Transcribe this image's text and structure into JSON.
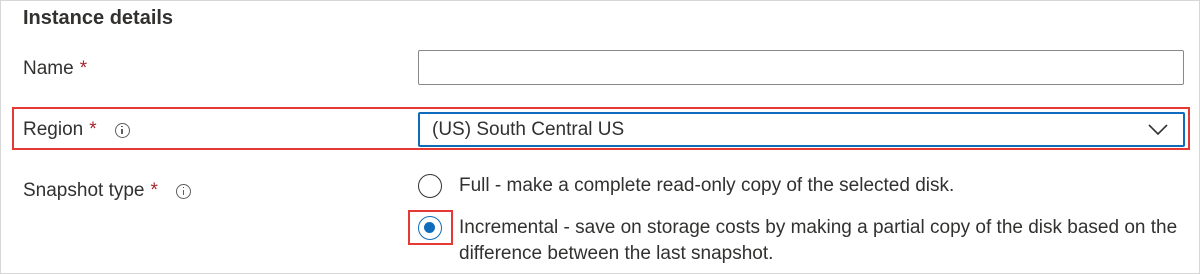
{
  "section": {
    "title": "Instance details"
  },
  "name_field": {
    "label": "Name",
    "required_mark": "*",
    "value": "",
    "placeholder": ""
  },
  "region_field": {
    "label": "Region",
    "required_mark": "*",
    "info_icon": "info-icon",
    "selected_value": "(US) South Central US",
    "dropdown_icon": "chevron-down-icon"
  },
  "snapshot_type": {
    "label": "Snapshot type",
    "required_mark": "*",
    "info_icon": "info-icon",
    "options": [
      {
        "label": "Full - make a complete read-only copy of the selected disk.",
        "selected": false
      },
      {
        "label": "Incremental - save on storage costs by making a partial copy of the disk based on the difference between the last snapshot.",
        "selected": true
      }
    ]
  },
  "colors": {
    "accent": "#0f6cbd",
    "required": "#a4262c",
    "highlight": "#e53935",
    "text": "#323130",
    "border": "#8a8886"
  }
}
